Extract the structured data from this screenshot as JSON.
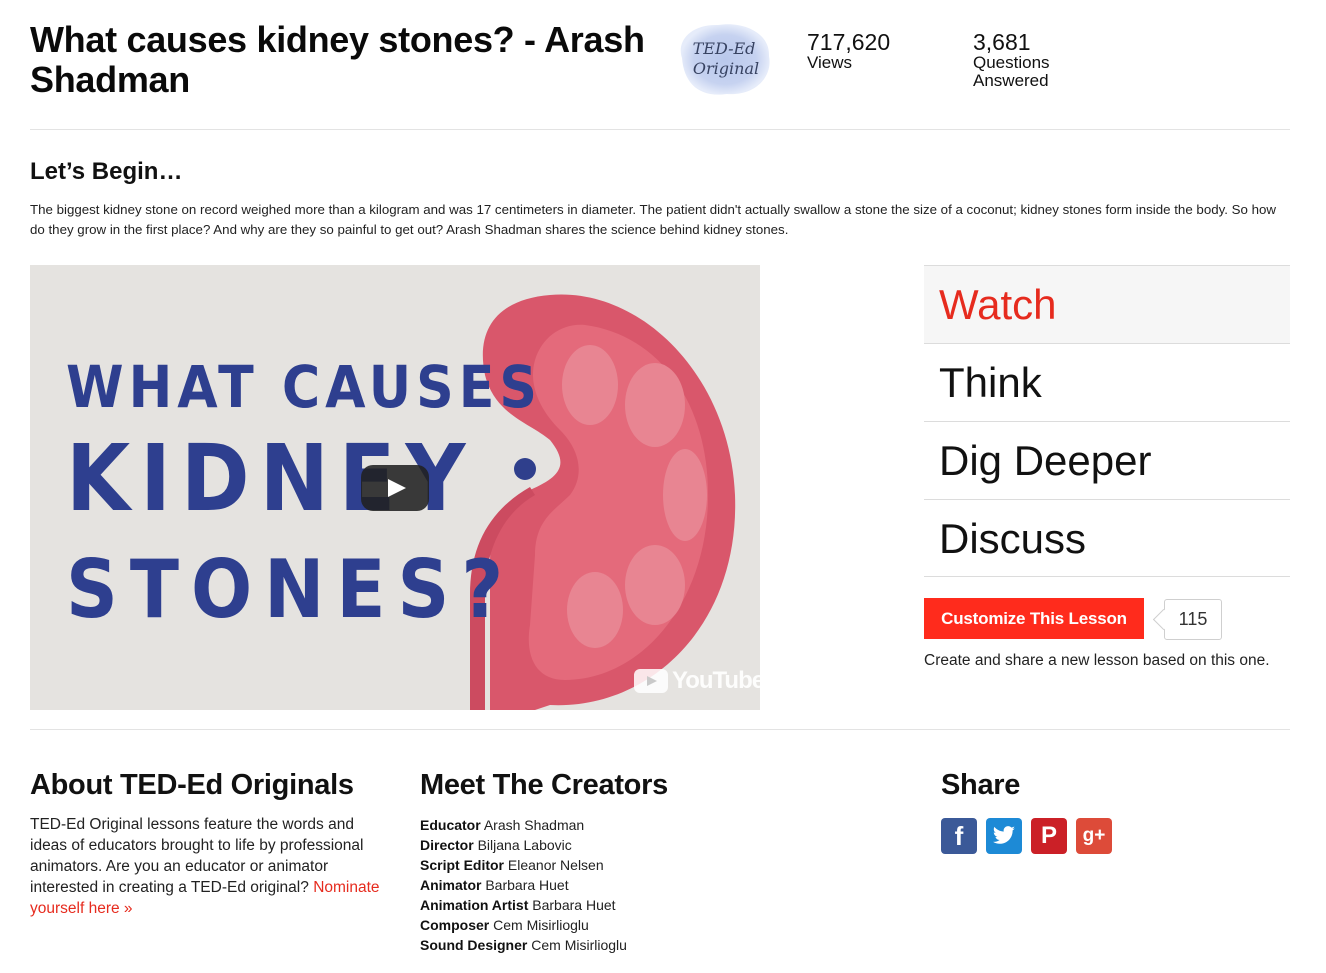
{
  "header": {
    "title": "What causes kidney stones? - Arash Shadman",
    "badge_text_line1": "TED-Ed",
    "badge_text_line2": "Original",
    "views_count": "717,620",
    "views_label": "Views",
    "answers_count": "3,681",
    "answers_label_line1": "Questions",
    "answers_label_line2": "Answered"
  },
  "intro": {
    "heading": "Let’s Begin…",
    "description": "The biggest kidney stone on record weighed more than a kilogram and was 17 centimeters in diameter. The patient didn't actually swallow a stone the size of a coconut; kidney stones form inside the body. So how do they grow in the first place? And why are they so painful to get out? Arash Shadman shares the science behind kidney stones."
  },
  "video": {
    "thumbnail_line1": "WHAT CAUSES",
    "thumbnail_line2": "KIDNEY",
    "thumbnail_line3": "STONES?",
    "youtube_label": "YouTube"
  },
  "tabs": [
    {
      "label": "Watch",
      "active": true
    },
    {
      "label": "Think",
      "active": false
    },
    {
      "label": "Dig Deeper",
      "active": false
    },
    {
      "label": "Discuss",
      "active": false
    }
  ],
  "customize": {
    "button_label": "Customize This Lesson",
    "count": "115",
    "note": "Create and share a new lesson based on this one."
  },
  "about": {
    "heading": "About TED-Ed Originals",
    "text": "TED-Ed Original lessons feature the words and ideas of educators brought to life by professional animators. Are you an educator or animator interested in creating a TED-Ed original?",
    "link_text": "Nominate yourself here »"
  },
  "creators": {
    "heading": "Meet The Creators",
    "items": [
      {
        "role": "Educator",
        "name": "Arash Shadman"
      },
      {
        "role": "Director",
        "name": "Biljana Labovic"
      },
      {
        "role": "Script Editor",
        "name": "Eleanor Nelsen"
      },
      {
        "role": "Animator",
        "name": "Barbara Huet"
      },
      {
        "role": "Animation Artist",
        "name": "Barbara Huet"
      },
      {
        "role": "Composer",
        "name": "Cem Misirlioglu"
      },
      {
        "role": "Sound Designer",
        "name": "Cem Misirlioglu"
      }
    ]
  },
  "share": {
    "heading": "Share",
    "buttons": [
      {
        "name": "facebook",
        "glyph": "f",
        "color": "#3b5998"
      },
      {
        "name": "twitter",
        "glyph": "",
        "color": "#1d8ad6"
      },
      {
        "name": "pinterest",
        "glyph": "P",
        "color": "#cb2027"
      },
      {
        "name": "google-plus",
        "glyph": "g+",
        "color": "#dd4b39"
      }
    ]
  },
  "colors": {
    "accent_red": "#e62b1e",
    "button_red": "#ff2b1c",
    "thumbnail_text_blue": "#2e3f8f",
    "kidney_red": "#d9576b"
  }
}
